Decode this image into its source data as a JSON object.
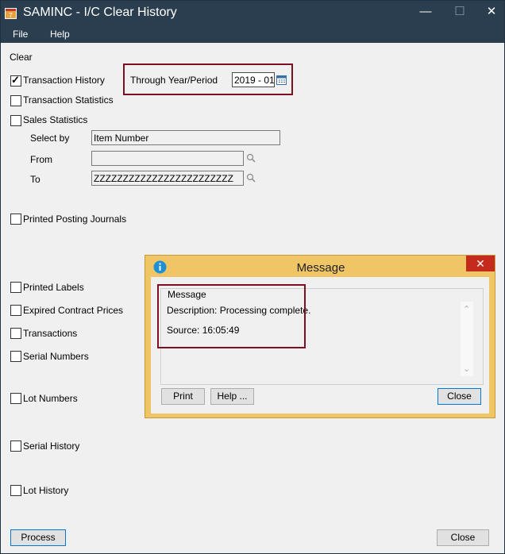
{
  "window": {
    "title": "SAMINC - I/C Clear History",
    "controls": {
      "minimize": "—",
      "maximize": "☐",
      "close": "✕"
    }
  },
  "menu": {
    "file": "File",
    "help": "Help"
  },
  "clear": {
    "heading": "Clear",
    "transaction_history": {
      "label": "Transaction History",
      "checked": true
    },
    "through_label": "Through Year/Period",
    "through_value": "2019 - 01",
    "transaction_statistics": {
      "label": "Transaction Statistics",
      "checked": false
    },
    "sales_statistics": {
      "label": "Sales Statistics",
      "checked": false
    },
    "select_by_label": "Select by",
    "select_by_value": "Item Number",
    "from_label": "From",
    "from_value": "",
    "to_label": "To",
    "to_value": "ZZZZZZZZZZZZZZZZZZZZZZZZ",
    "printed_posting_journals": {
      "label": "Printed Posting Journals",
      "checked": false
    },
    "printed_labels": {
      "label": "Printed Labels",
      "checked": false
    },
    "expired_contract_prices": {
      "label": "Expired Contract Prices",
      "checked": false
    },
    "transactions": {
      "label": "Transactions",
      "checked": false
    },
    "serial_numbers": {
      "label": "Serial Numbers",
      "checked": false
    },
    "lot_numbers": {
      "label": "Lot Numbers",
      "checked": false
    },
    "serial_history": {
      "label": "Serial History",
      "checked": false
    },
    "lot_history": {
      "label": "Lot History",
      "checked": false
    }
  },
  "footer": {
    "process": "Process",
    "close": "Close"
  },
  "dialog": {
    "title": "Message",
    "close": "✕",
    "group_label": "Message",
    "description": "Description: Processing complete.",
    "source": "Source:  16:05:49",
    "print": "Print",
    "help": "Help ...",
    "close_button": "Close",
    "scroll_up": "⌃",
    "scroll_down": "⌄"
  },
  "colors": {
    "titlebar": "#2b3e4f",
    "highlight": "#7a1020",
    "dialog_frame": "#efc565",
    "info_icon": "#1e90d6",
    "dialog_close": "#c42b1c"
  }
}
